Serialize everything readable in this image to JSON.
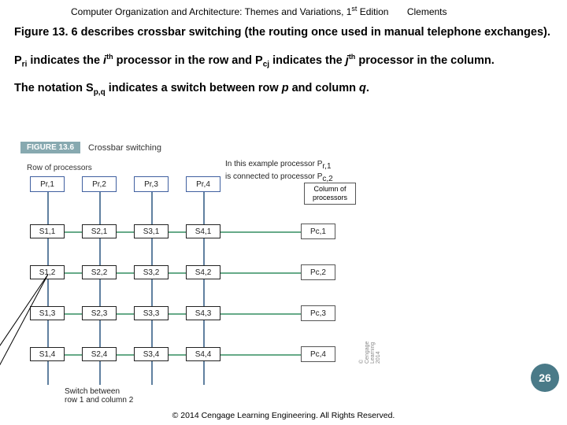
{
  "header": {
    "book": "Computer Organization and Architecture: Themes and Variations, 1",
    "edition_sup": "st",
    "edition_word": "Edition",
    "author": "Clements"
  },
  "para1_a": "Figure 13. 6 describes crossbar switching (the routing once used in manual telephone exchanges).",
  "para2_a": "P",
  "para2_ri": "ri",
  "para2_b": " indicates the ",
  "para2_i": "i",
  "para2_th": "th",
  "para2_c": " processor in the row and P",
  "para2_cj": "cj",
  "para2_d": " indicates the ",
  "para2_j": "j",
  "para2_th2": "th",
  "para2_e": " processor in the column.",
  "para3_a": "The notation S",
  "para3_pq": "p,q",
  "para3_b": " indicates a switch between row ",
  "para3_p": "p",
  "para3_c": " and column ",
  "para3_q": "q",
  "para3_d": ".",
  "figure": {
    "num": "FIGURE 13.6",
    "title": "Crossbar switching",
    "row_label": "Row of processors",
    "col_label_l1": "Column of",
    "col_label_l2": "processors",
    "info_l1": "In this example processor P",
    "info_sub1": "r,1",
    "info_l2": "is connected to processor P",
    "info_sub2": "c,2",
    "anno_l1": "Switch between",
    "anno_l2": "row 1 and column 2"
  },
  "pr": [
    "Pr,1",
    "Pr,2",
    "Pr,3",
    "Pr,4"
  ],
  "pc": [
    "Pc,1",
    "Pc,2",
    "Pc,3",
    "Pc,4"
  ],
  "sw": [
    [
      "S1,1",
      "S2,1",
      "S3,1",
      "S4,1"
    ],
    [
      "S1,2",
      "S2,2",
      "S3,2",
      "S4,2"
    ],
    [
      "S1,3",
      "S2,3",
      "S3,3",
      "S4,3"
    ],
    [
      "S1,4",
      "S2,4",
      "S3,4",
      "S4,4"
    ]
  ],
  "page": "26",
  "footer": "© 2014 Cengage Learning Engineering. All Rights Reserved.",
  "copyright_vert": "© Cengage Learning 2014"
}
